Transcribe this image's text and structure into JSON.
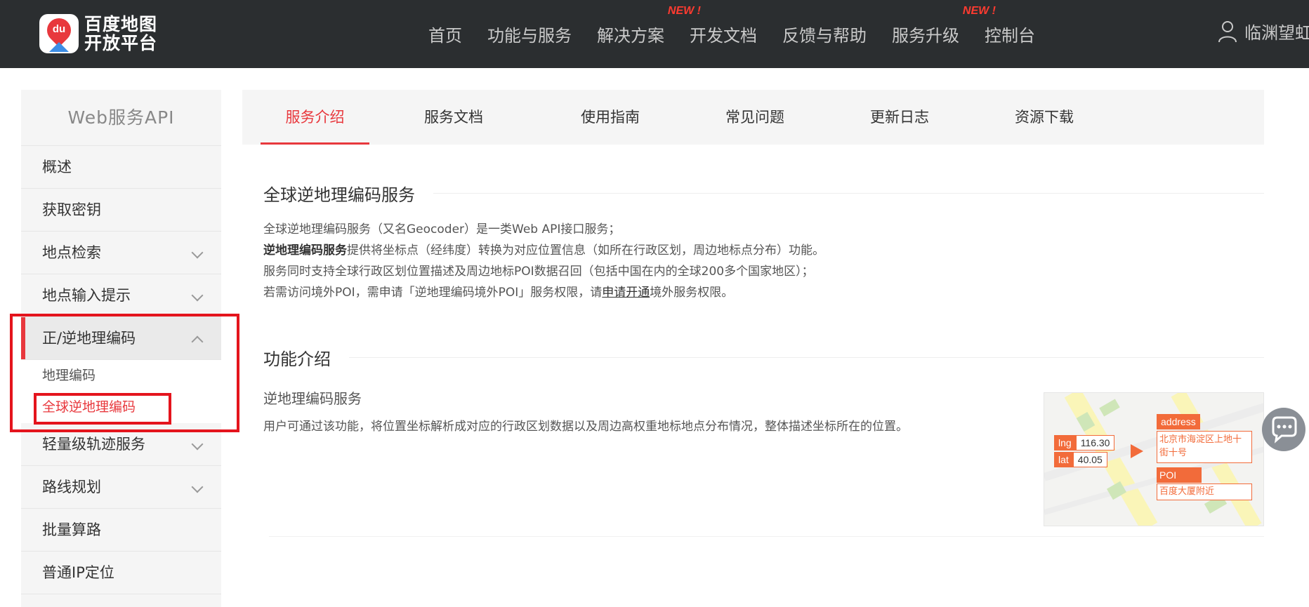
{
  "header": {
    "logo_line1": "百度地图",
    "logo_line2": "开放平台",
    "logo_badge": "du",
    "nav": [
      {
        "label": "首页",
        "badge": ""
      },
      {
        "label": "功能与服务",
        "badge": ""
      },
      {
        "label": "解决方案",
        "badge": "NEW !"
      },
      {
        "label": "开发文档",
        "badge": ""
      },
      {
        "label": "反馈与帮助",
        "badge": ""
      },
      {
        "label": "服务升级",
        "badge": "NEW !"
      },
      {
        "label": "控制台",
        "badge": ""
      }
    ],
    "user_name": "临渊望虹"
  },
  "sidebar": {
    "title": "Web服务API",
    "items": [
      {
        "label": "概述"
      },
      {
        "label": "获取密钥"
      },
      {
        "label": "地点检索"
      },
      {
        "label": "地点输入提示"
      },
      {
        "label": "正/逆地理编码"
      },
      {
        "label": "轻量级轨迹服务"
      },
      {
        "label": "路线规划"
      },
      {
        "label": "批量算路"
      },
      {
        "label": "普通IP定位"
      }
    ],
    "subitems": [
      {
        "label": "地理编码"
      },
      {
        "label": "全球逆地理编码"
      }
    ]
  },
  "tabs": [
    "服务介绍",
    "服务文档",
    "使用指南",
    "常见问题",
    "更新日志",
    "资源下载"
  ],
  "content": {
    "section1_title": "全球逆地理编码服务",
    "p1": "全球逆地理编码服务（又名Geocoder）是一类Web API接口服务；",
    "p2_bold": "逆地理编码服务",
    "p2_rest": "提供将坐标点（经纬度）转换为对应位置信息（如所在行政区划，周边地标点分布）功能。",
    "p3": "服务同时支持全球行政区划位置描述及周边地标POI数据召回（包括中国在内的全球200多个国家地区）；",
    "p4_before": "若需访问境外POI，需申请「逆地理编码境外POI」服务权限，请",
    "p4_link": "申请开通",
    "p4_after": "境外服务权限。",
    "section2_title": "功能介绍",
    "feature_title": "逆地理编码服务",
    "feature_desc": "用户可通过该功能，将位置坐标解析成对应的行政区划数据以及周边高权重地标地点分布情况，整体描述坐标所在的位置。"
  },
  "illustration": {
    "lng_key": "lng",
    "lng_value": "116.30",
    "lat_key": "lat",
    "lat_value": "40.05",
    "address_key": "address",
    "address_value": "北京市海淀区上地十街十号",
    "poi_key": "POI",
    "poi_value": "百度大厦附近"
  },
  "colors": {
    "accent": "#e8383d",
    "topbar": "#2b2e30",
    "illus_orange": "#f26b3a"
  }
}
